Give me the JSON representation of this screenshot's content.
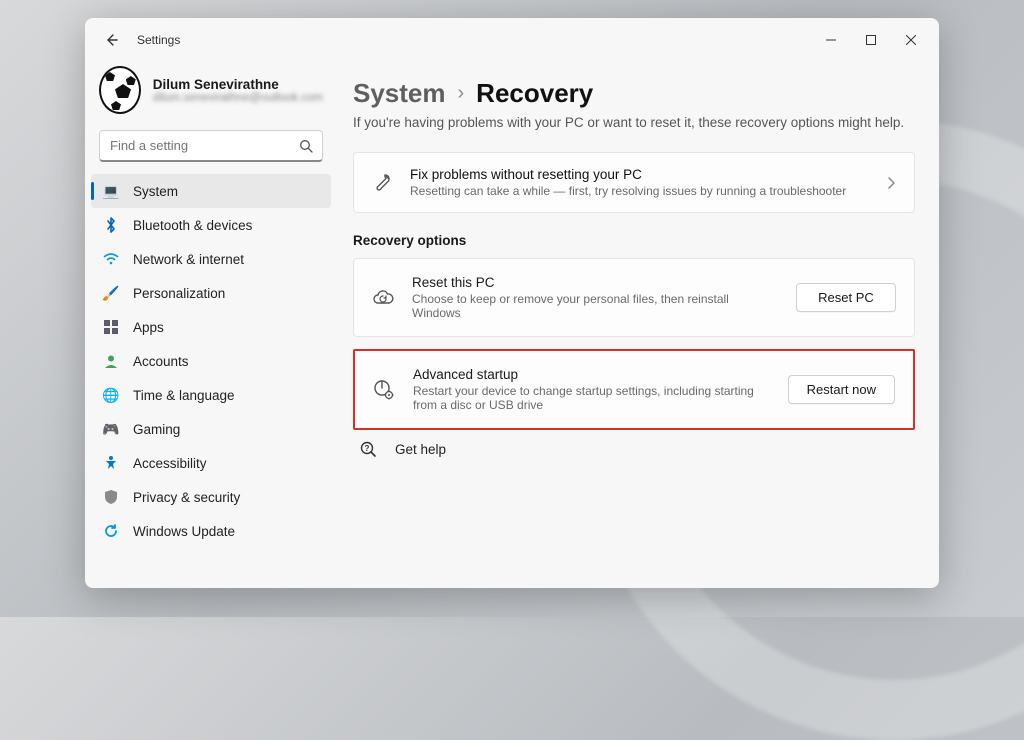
{
  "window": {
    "title": "Settings"
  },
  "user": {
    "name": "Dilum Senevirathne",
    "email": "dilum.senevirathne@outlook.com"
  },
  "search": {
    "placeholder": "Find a setting"
  },
  "sidebar": {
    "items": [
      {
        "label": "System",
        "icon": "display-icon",
        "color": "#0067c0",
        "active": true
      },
      {
        "label": "Bluetooth & devices",
        "icon": "bluetooth-icon",
        "color": "#0067c0"
      },
      {
        "label": "Network & internet",
        "icon": "wifi-icon",
        "color": "#0099e6"
      },
      {
        "label": "Personalization",
        "icon": "brush-icon",
        "color": "#c0603e"
      },
      {
        "label": "Apps",
        "icon": "apps-icon",
        "color": "#5b5b6a"
      },
      {
        "label": "Accounts",
        "icon": "person-icon",
        "color": "#3fa35a"
      },
      {
        "label": "Time & language",
        "icon": "globe-clock-icon",
        "color": "#2f8fcf"
      },
      {
        "label": "Gaming",
        "icon": "gamepad-icon",
        "color": "#6a6a6a"
      },
      {
        "label": "Accessibility",
        "icon": "accessibility-icon",
        "color": "#0078d4"
      },
      {
        "label": "Privacy & security",
        "icon": "shield-icon",
        "color": "#8a8a8a"
      },
      {
        "label": "Windows Update",
        "icon": "update-icon",
        "color": "#0099e6"
      }
    ]
  },
  "breadcrumb": {
    "parent": "System",
    "current": "Recovery"
  },
  "intro": "If you're having problems with your PC or want to reset it, these recovery options might help.",
  "troubleshoot": {
    "title": "Fix problems without resetting your PC",
    "desc": "Resetting can take a while — first, try resolving issues by running a troubleshooter"
  },
  "section_title": "Recovery options",
  "reset": {
    "title": "Reset this PC",
    "desc": "Choose to keep or remove your personal files, then reinstall Windows",
    "button": "Reset PC"
  },
  "advanced": {
    "title": "Advanced startup",
    "desc": "Restart your device to change startup settings, including starting from a disc or USB drive",
    "button": "Restart now"
  },
  "help": {
    "label": "Get help"
  }
}
